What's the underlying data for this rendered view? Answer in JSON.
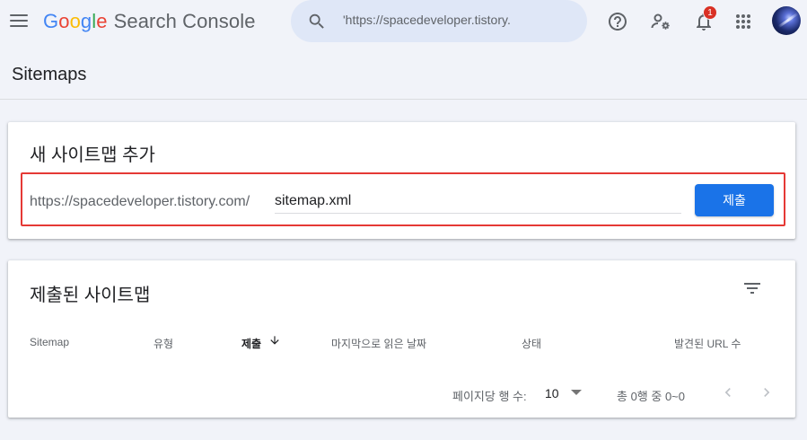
{
  "header": {
    "logo_letters": [
      {
        "ch": "G",
        "color": "#4285F4"
      },
      {
        "ch": "o",
        "color": "#EA4335"
      },
      {
        "ch": "o",
        "color": "#FBBC05"
      },
      {
        "ch": "g",
        "color": "#4285F4"
      },
      {
        "ch": "l",
        "color": "#34A853"
      },
      {
        "ch": "e",
        "color": "#EA4335"
      }
    ],
    "product_name": "Search Console",
    "search_text": "'https://spacedeveloper.tistory.",
    "notification_count": "1",
    "icons": [
      "menu-icon",
      "search-icon",
      "help-icon",
      "manage-users-icon",
      "notifications-icon",
      "apps-icon",
      "avatar"
    ]
  },
  "page": {
    "title": "Sitemaps"
  },
  "add_sitemap": {
    "title": "새 사이트맵 추가",
    "url_prefix": "https://spacedeveloper.tistory.com/",
    "input_value": "sitemap.xml",
    "submit_label": "제출",
    "accent": "#1a73e8",
    "highlight_color": "#e53935"
  },
  "submitted": {
    "title": "제출된 사이트맵",
    "columns": [
      "Sitemap",
      "유형",
      "제출",
      "마지막으로 읽은 날짜",
      "상태",
      "발견된 URL 수"
    ],
    "sorted_column": "제출",
    "rows_per_page_label": "페이지당 행 수:",
    "rows_per_page_value": "10",
    "range_text": "총 0행 중 0~0"
  }
}
